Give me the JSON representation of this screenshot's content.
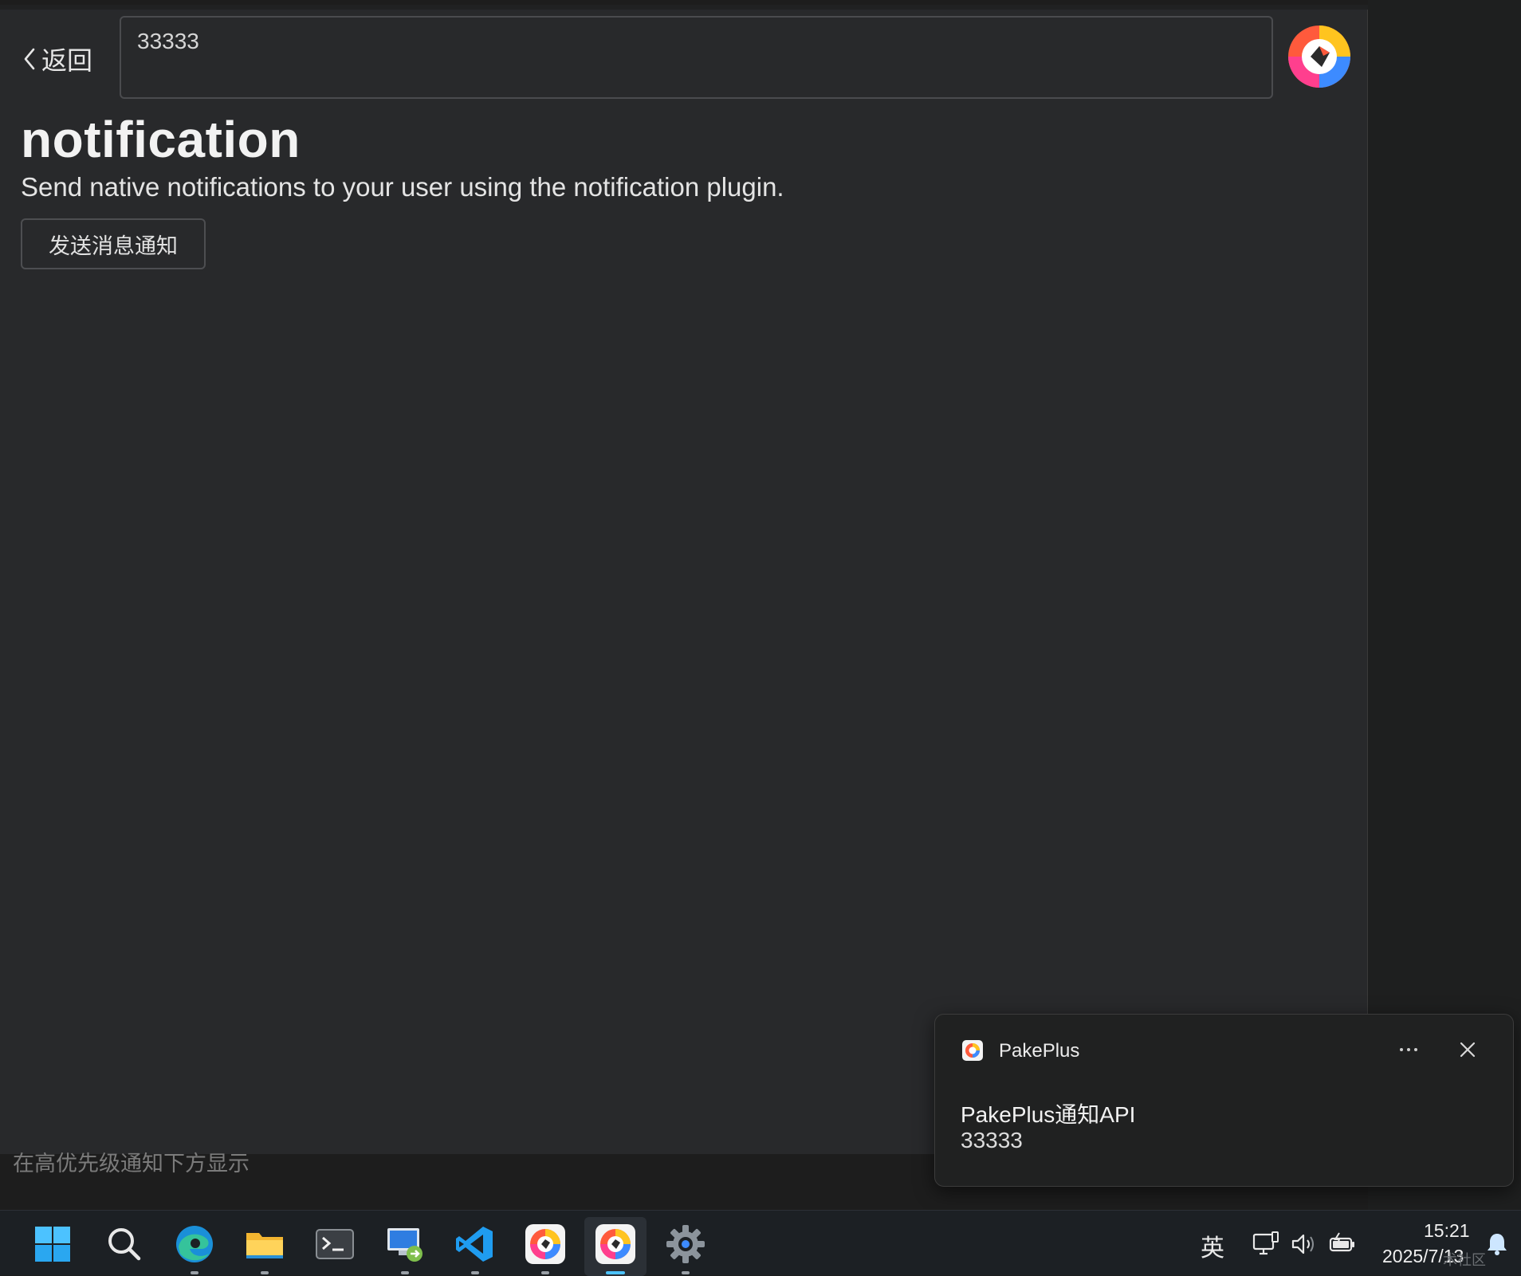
{
  "app": {
    "back_label": "返回",
    "message_value": "33333",
    "title": "notification",
    "description": "Send native notifications to your user using the notification plugin.",
    "send_button_label": "发送消息通知",
    "logo_icon": "pakeplus-logo-icon"
  },
  "below_window_hint": "在高优先级通知下方显示",
  "toast": {
    "app_name": "PakePlus",
    "title": "PakePlus通知API",
    "body": "33333",
    "more_icon": "more-icon",
    "close_icon": "close-icon"
  },
  "taskbar": {
    "apps": [
      "start-icon",
      "search-icon",
      "edge-icon",
      "file-explorer-icon",
      "terminal-icon",
      "remote-desktop-icon",
      "vscode-icon",
      "pakeplus-icon",
      "pakeplus-active-icon",
      "settings-icon"
    ],
    "ime": "英",
    "tray_icons": [
      "network-icon",
      "volume-icon",
      "battery-icon"
    ],
    "time": "15:21",
    "date": "2025/7/13",
    "watermark": "术社区",
    "notification_icon": "bell-icon"
  },
  "colors": {
    "window_bg": "#28292b",
    "toast_bg": "#202121",
    "taskbar_bg": "#1c2024",
    "accent": "#4cc2ff"
  }
}
